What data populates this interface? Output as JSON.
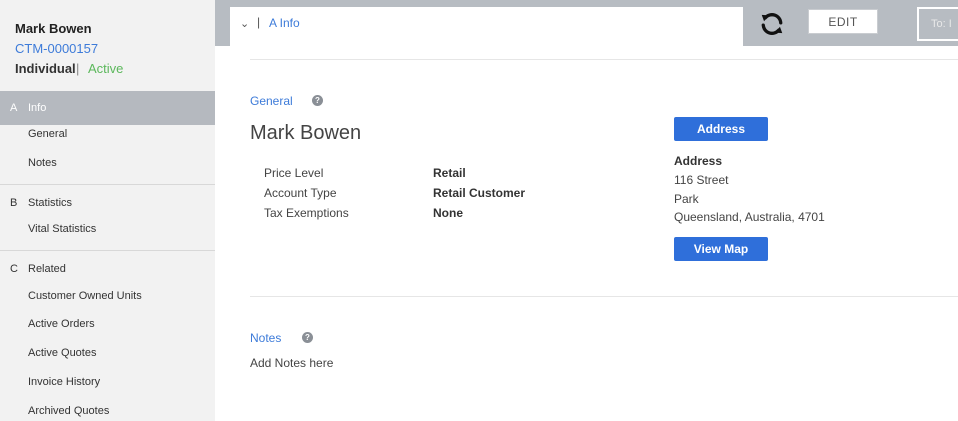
{
  "customer": {
    "name": "Mark Bowen",
    "id": "CTM-0000157",
    "type": "Individual",
    "separator": "|",
    "status": "Active"
  },
  "sidebar": {
    "sections": [
      {
        "letter": "A",
        "title": "Info",
        "items": [
          "General",
          "Notes"
        ]
      },
      {
        "letter": "B",
        "title": "Statistics",
        "items": [
          "Vital Statistics"
        ]
      },
      {
        "letter": "C",
        "title": "Related",
        "items": [
          "Customer Owned Units",
          "Active Orders",
          "Active Quotes",
          "Invoice History",
          "Archived Quotes"
        ]
      }
    ]
  },
  "topbar": {
    "tab_chevron": "⌄",
    "tab_separator": "|",
    "tab_label": "A Info",
    "edit_label": "EDIT",
    "to_field": "To: I"
  },
  "general": {
    "title": "General",
    "name": "Mark Bowen",
    "fields": [
      {
        "label": "Price Level",
        "value": "Retail"
      },
      {
        "label": "Account Type",
        "value": "Retail Customer"
      },
      {
        "label": "Tax Exemptions",
        "value": "None"
      }
    ]
  },
  "address": {
    "button_label": "Address",
    "heading": "Address",
    "lines": [
      "116  Street",
      "Park",
      "Queensland, Australia, 4701"
    ],
    "map_button_label": "View Map"
  },
  "notes": {
    "title": "Notes",
    "placeholder": "Add Notes here"
  },
  "icons": {
    "help": "?",
    "sync": "sync-icon"
  },
  "colors": {
    "accent": "#3d7bd9",
    "button": "#2f6fda",
    "status": "#5cb85c",
    "sidebar_active": "#b5b9bf",
    "topbar": "#b7bcc2"
  }
}
